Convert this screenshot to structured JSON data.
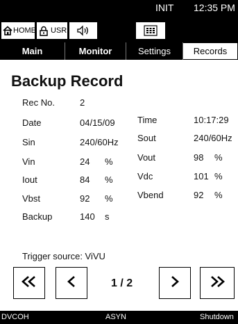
{
  "status": {
    "mode": "INIT",
    "time": "12:35 PM"
  },
  "quick": {
    "home_label": "HOME",
    "user_label": "USR"
  },
  "tabs": {
    "main": "Main",
    "monitor": "Monitor",
    "settings": "Settings",
    "records": "Records"
  },
  "record": {
    "title": "Backup Record",
    "rec_no_label": "Rec No.",
    "rec_no": "2",
    "date_label": "Date",
    "date": "04/15/09",
    "time_label": "Time",
    "time": "10:17:29",
    "sin_label": "Sin",
    "sin": "240/60Hz",
    "sout_label": "Sout",
    "sout": "240/60Hz",
    "vin_label": "Vin",
    "vin": "24",
    "vin_unit": "%",
    "vout_label": "Vout",
    "vout": "98",
    "vout_unit": "%",
    "iout_label": "Iout",
    "iout": "84",
    "iout_unit": "%",
    "vdc_label": "Vdc",
    "vdc": "101",
    "vdc_unit": "%",
    "vbst_label": "Vbst",
    "vbst": "92",
    "vbst_unit": "%",
    "vbend_label": "Vbend",
    "vbend": "92",
    "vbend_unit": "%",
    "backup_label": "Backup",
    "backup": "140",
    "backup_unit": "s",
    "trigger": "Trigger source: ViVU"
  },
  "pager": {
    "indicator": "1 / 2"
  },
  "bottom": {
    "left": "DVCOH",
    "center": "ASYN",
    "right": "Shutdown"
  }
}
